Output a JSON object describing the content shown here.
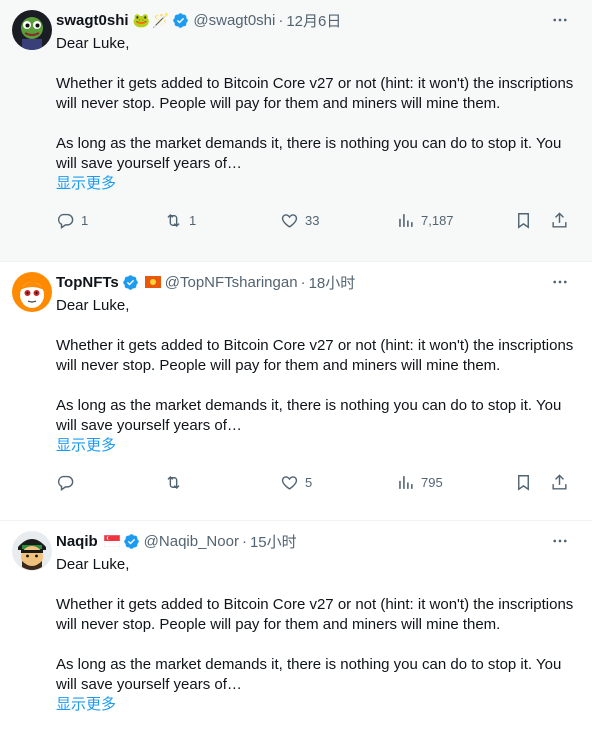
{
  "tweets": [
    {
      "name": "swagt0shi",
      "emojis": [
        "🐸",
        "🪄"
      ],
      "handle": "@swagt0shi",
      "dot": "·",
      "time": "12月6日",
      "lines": [
        "Dear Luke,",
        "",
        "Whether it gets added to Bitcoin Core v27 or not (hint: it won't) the inscriptions will never stop. People will pay for them and miners will mine them.",
        "",
        "As long as the market demands it, there is nothing you can do to stop it. You will save yourself years of…"
      ],
      "show_more": "显示更多",
      "replies": "1",
      "retweets": "1",
      "likes": "33",
      "views": "7,187"
    },
    {
      "name": "TopNFTs",
      "handle": "@TopNFTsharingan",
      "dot": "·",
      "time": "18小时",
      "lines": [
        "Dear Luke,",
        "",
        "Whether it gets added to Bitcoin Core v27 or not (hint: it won't) the inscriptions will never stop. People will pay for them and miners will mine them.",
        "",
        "As long as the market demands it, there is nothing you can do to stop it. You will save yourself years of…"
      ],
      "show_more": "显示更多",
      "replies": "",
      "retweets": "",
      "likes": "5",
      "views": "795"
    },
    {
      "name": "Naqib",
      "handle": "@Naqib_Noor",
      "dot": "·",
      "time": "15小时",
      "lines": [
        "Dear Luke,",
        "",
        "Whether it gets added to Bitcoin Core v27 or not (hint: it won't) the inscriptions will never stop. People will pay for them and miners will mine them.",
        "",
        "As long as the market demands it, there is nothing you can do to stop it. You will save yourself years of…"
      ],
      "show_more": "显示更多"
    }
  ],
  "icons": {
    "reply": "reply-icon",
    "retweet": "retweet-icon",
    "like": "heart-icon",
    "views": "views-icon",
    "bookmark": "bookmark-icon",
    "share": "share-icon",
    "more": "more-icon",
    "verified": "verified-badge-icon"
  },
  "colors": {
    "link": "#1d9bf0",
    "muted": "#536471",
    "text": "#0f1419",
    "verified": "#1d9bf0",
    "highlight_bg": "#f7f9f9"
  }
}
